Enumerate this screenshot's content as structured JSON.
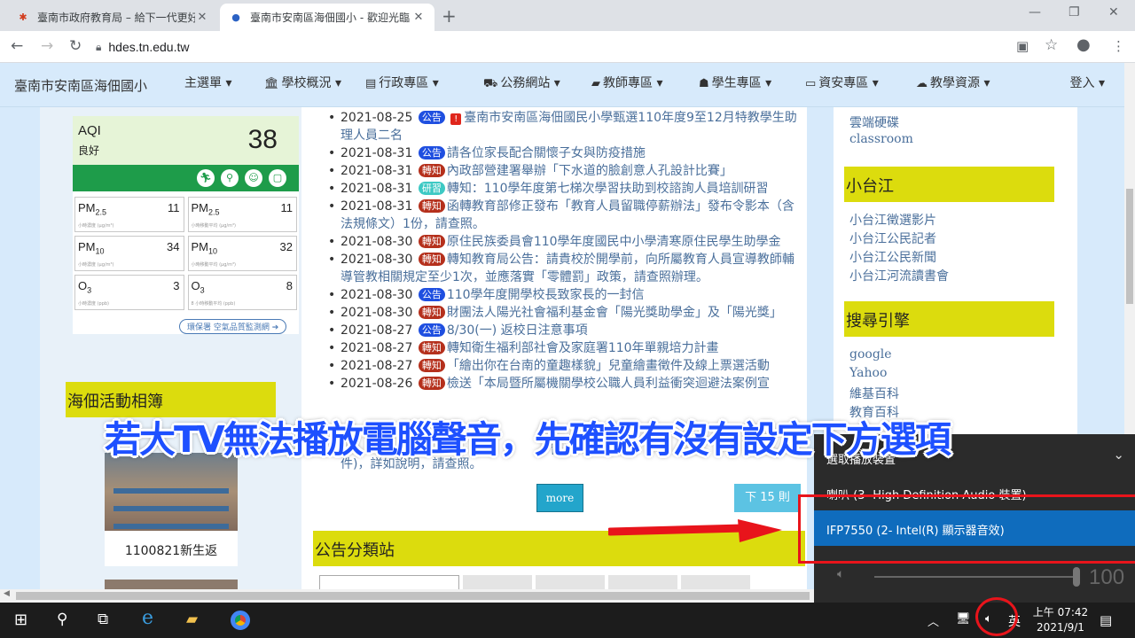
{
  "browser": {
    "tabs": [
      {
        "title": "臺南市政府教育局 – 給下一代更好"
      },
      {
        "title": "臺南市安南區海佃國小 - 歡迎光臨"
      }
    ],
    "url": "hdes.tn.edu.tw"
  },
  "nav": {
    "brand": "臺南市安南區海佃國小",
    "items": [
      {
        "label": "主選單 ▾",
        "icon": ""
      },
      {
        "label": "學校概況 ▾",
        "icon": "bank-icon"
      },
      {
        "label": "行政專區 ▾",
        "icon": "document-icon"
      },
      {
        "label": "公務網站 ▾",
        "icon": "truck-icon"
      },
      {
        "label": "教師專區 ▾",
        "icon": "book-icon"
      },
      {
        "label": "學生專區 ▾",
        "icon": "android-icon"
      },
      {
        "label": "資安專區 ▾",
        "icon": "monitor-icon"
      },
      {
        "label": "教學資源 ▾",
        "icon": "cloud-icon"
      }
    ],
    "login": "登入 ▾"
  },
  "aqi": {
    "label": "AQI",
    "status": "良好",
    "value": "38",
    "colors": {
      "good": "#1e9c4a"
    },
    "cells": [
      {
        "name": "PM",
        "sub": "2.5",
        "value": "11",
        "unit": "小時濃度 (μg/m³)"
      },
      {
        "name": "PM",
        "sub": "2.5",
        "value": "11",
        "unit": "小時移動平均 (μg/m³)"
      },
      {
        "name": "PM",
        "sub": "10",
        "value": "34",
        "unit": "小時濃度 (μg/m³)"
      },
      {
        "name": "PM",
        "sub": "10",
        "value": "32",
        "unit": "小時移動平均 (μg/m³)"
      },
      {
        "name": "O",
        "sub": "3",
        "value": "3",
        "unit": "小時濃度 (ppb)"
      },
      {
        "name": "O",
        "sub": "3",
        "value": "8",
        "unit": "8 小時移動平均 (ppb)"
      }
    ],
    "link": "環保署 空氣品質監測網 ➔"
  },
  "album": {
    "heading": "海佃活動相簿",
    "photo_caption": "1100821新生返"
  },
  "announcements": [
    {
      "date": "2021-08-25",
      "badge": "公告",
      "type": "blue",
      "warn": true,
      "text": "臺南市安南區海佃國民小學甄選110年度9至12月特教學生助理人員二名"
    },
    {
      "date": "2021-08-31",
      "badge": "公告",
      "type": "blue",
      "warn": false,
      "text": "請各位家長配合關懷子女與防疫措施"
    },
    {
      "date": "2021-08-31",
      "badge": "轉知",
      "type": "red",
      "warn": false,
      "text": "內政部營建署舉辦「下水道的臉創意人孔設計比賽」"
    },
    {
      "date": "2021-08-31",
      "badge": "研習",
      "type": "teal",
      "warn": false,
      "text": "轉知：110學年度第七梯次學習扶助到校諮詢人員培訓研習"
    },
    {
      "date": "2021-08-31",
      "badge": "轉知",
      "type": "red",
      "warn": false,
      "text": "函轉教育部修正發布「教育人員留職停薪辦法」發布令影本（含法規條文）1份，請查照。"
    },
    {
      "date": "2021-08-30",
      "badge": "轉知",
      "type": "red",
      "warn": false,
      "text": "原住民族委員會110學年度國民中小學清寒原住民學生助學金"
    },
    {
      "date": "2021-08-30",
      "badge": "轉知",
      "type": "red",
      "warn": false,
      "text": "轉知教育局公告：請貴校於開學前，向所屬教育人員宣導教師輔導管教相關規定至少1次，並應落實「零體罰」政策，請查照辦理。"
    },
    {
      "date": "2021-08-30",
      "badge": "公告",
      "type": "blue",
      "warn": false,
      "text": "110學年度開學校長致家長的一封信"
    },
    {
      "date": "2021-08-30",
      "badge": "轉知",
      "type": "red",
      "warn": false,
      "text": "財團法人陽光社會福利基金會「陽光獎助學金」及「陽光獎」"
    },
    {
      "date": "2021-08-27",
      "badge": "公告",
      "type": "blue",
      "warn": false,
      "text": "8/30(一) 返校日注意事項"
    },
    {
      "date": "2021-08-27",
      "badge": "轉知",
      "type": "red",
      "warn": false,
      "text": "轉知衛生福利部社會及家庭署110年單親培力計畫"
    },
    {
      "date": "2021-08-27",
      "badge": "轉知",
      "type": "red",
      "warn": false,
      "text": "「繪出你在台南的童趣樣貌」兒童繪畫徵件及線上票選活動"
    },
    {
      "date": "2021-08-26",
      "badge": "轉知",
      "type": "red",
      "warn": false,
      "text": "檢送「本局暨所屬機關學校公職人員利益衝突迴避法案例宣"
    }
  ],
  "ann_tail": "育人員",
  "ann_tail2": "件)，詳如說明，請查照。",
  "buttons": {
    "more": "more",
    "next": "下 15 則"
  },
  "categories": {
    "heading": "公告分類站"
  },
  "right": {
    "links_top": [
      "雲端硬碟",
      "classroom"
    ],
    "section1": "小台江",
    "links1": [
      "小台江徵選影片",
      "小台江公民記者",
      "小台江公民新聞",
      "小台江河流讀書會"
    ],
    "section2": "搜尋引擎",
    "links2": [
      "google",
      "Yahoo",
      "維基百科",
      "教育百科"
    ]
  },
  "overlay": {
    "caption": "若大TV無法播放電腦聲音，先確認有沒有設定下方選項",
    "colors": {
      "caption": "#1e50ff",
      "highlight": "#e8141b"
    }
  },
  "audio": {
    "title": "選取播放裝置",
    "option1": "喇叭 (3- High Definition Audio 裝置)",
    "option2": "IFP7550 (2- Intel(R) 顯示器音效)",
    "volume": "100"
  },
  "taskbar": {
    "lang": "英",
    "time": "上午 07:42",
    "date": "2021/9/1"
  }
}
